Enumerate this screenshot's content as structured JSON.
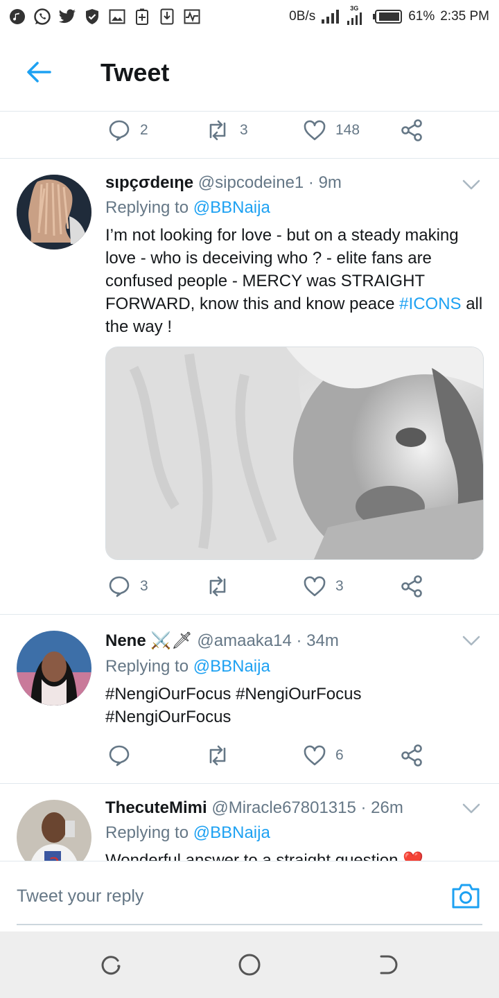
{
  "status_bar": {
    "net_speed": "0B/s",
    "network_label": "3G",
    "battery": "61%",
    "time": "2:35 PM"
  },
  "header": {
    "title": "Tweet"
  },
  "top_actions": {
    "replies": "2",
    "retweets": "3",
    "likes": "148"
  },
  "tweets": [
    {
      "name": "sιpçσdeιηe",
      "handle": "@sipcodeine1 · 9m",
      "replying_prefix": "Replying to ",
      "replying_to": "@BBNaija",
      "text_before": "I’m not looking for love - but on a steady making love - who is deceiving who ? - elite fans are confused people - MERCY was STRAIGHT FORWARD, know this and know peace ",
      "hashtag": "#ICONS",
      "text_after": " all the way !",
      "replies": "3",
      "retweets": "",
      "likes": "3"
    },
    {
      "name": "Nene",
      "name_emoji": "⚔️🗡",
      "handle": "@amaaka14 · 34m",
      "replying_prefix": "Replying to ",
      "replying_to": "@BBNaija",
      "hashtags": "#NengiOurFocus #NengiOurFocus #NengiOurFocus",
      "replies": "",
      "retweets": "",
      "likes": "6"
    },
    {
      "name": "ThecuteMimi",
      "handle": "@Miracle67801315 · 26m",
      "replying_prefix": "Replying to ",
      "replying_to": "@BBNaija",
      "text": "Wonderful answer to a straight question ❤️"
    }
  ],
  "composer": {
    "placeholder": "Tweet your reply"
  },
  "colors": {
    "accent": "#1da1f2",
    "muted": "#657786",
    "heart": "#e0245e"
  },
  "icons": [
    "back-arrow-icon",
    "reply-icon",
    "retweet-icon",
    "like-icon",
    "share-icon",
    "chevron-down-icon",
    "camera-icon",
    "recent-apps-icon",
    "home-icon",
    "back-nav-icon"
  ]
}
